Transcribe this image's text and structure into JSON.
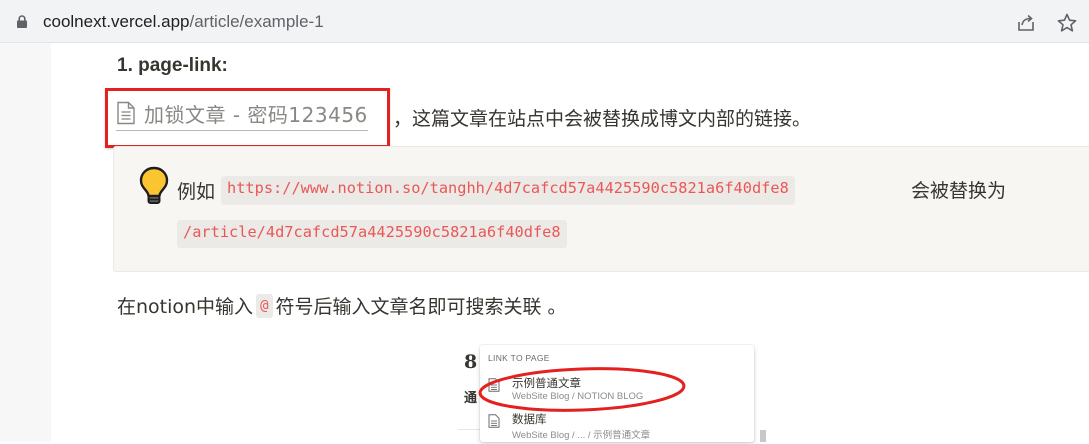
{
  "browser": {
    "url_host": "coolnext.vercel.app",
    "url_path": "/article/example-1"
  },
  "article": {
    "heading": "1. page-link:",
    "page_link_label": "加锁文章 - 密码123456",
    "sentence1": "，这篇文章在站点中会被替换成博文内部的链接。",
    "callout": {
      "lead": "例如",
      "code1": "https://www.notion.so/tanghh/4d7cafcd57a4425590c5821a6f40dfe8",
      "tail": "会被替换为",
      "code2": "/article/4d7cafcd57a4425590c5821a6f40dfe8"
    },
    "para_before": "在notion中输入",
    "para_code": "@",
    "para_after": "符号后输入文章名即可搜索关联 。"
  },
  "screenshot": {
    "bg_number": "8",
    "bg_char": "通",
    "menu_header": "LINK TO PAGE",
    "items": [
      {
        "title": "示例普通文章",
        "path": "WebSite Blog / NOTION BLOG"
      },
      {
        "title": "数据库",
        "path": "WebSite Blog / ... / 示例普通文章"
      }
    ]
  },
  "colors": {
    "highlight_red": "#e3211f",
    "code_red": "#eb5757",
    "callout_bg": "#f7f6f3"
  }
}
